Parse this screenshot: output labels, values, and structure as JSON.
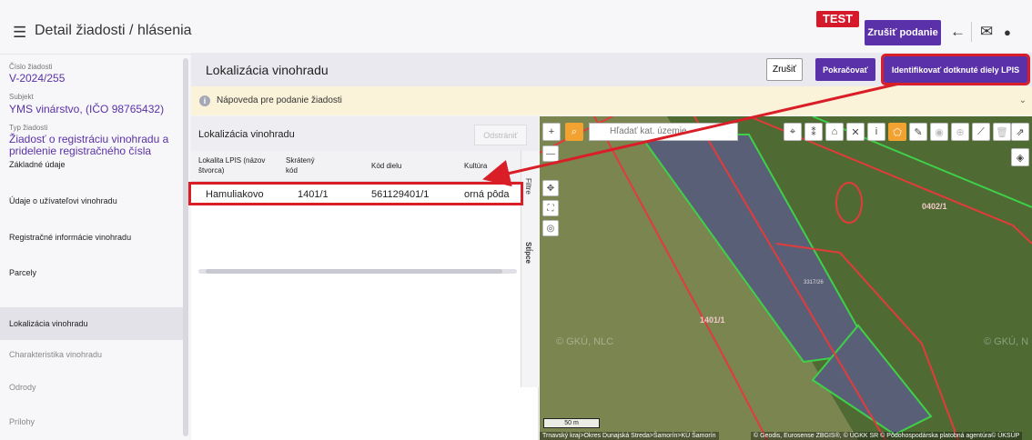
{
  "topbar": {
    "menu_icon": "☰",
    "title": "Detail žiadosti / hlásenia",
    "test_badge": "TEST",
    "cancel_label": "Zrušiť podanie",
    "back_icon": "←",
    "mail_icon": "✉",
    "user_icon": "●"
  },
  "sidebar": {
    "fields": [
      {
        "label": "Číslo žiadosti",
        "value": "V-2024/255"
      },
      {
        "label": "Subjekt",
        "value": "YMS vinárstvo, (IČO 98765432)"
      },
      {
        "label": "Typ žiadosti",
        "value": "Žiadosť o registráciu vinohradu a pridelenie registračného čísla"
      }
    ],
    "items": [
      {
        "label": "Základné údaje"
      },
      {
        "label": "Údaje o užívateľovi vinohradu"
      },
      {
        "label": "Registračné informácie vinohradu"
      },
      {
        "label": "Parcely"
      },
      {
        "label": "Lokalizácia vinohradu",
        "active": true
      },
      {
        "label": "Charakteristika vinohradu"
      },
      {
        "label": "Odrody"
      },
      {
        "label": "Prílohy"
      }
    ]
  },
  "section": {
    "title": "Lokalizácia vinohradu",
    "cancel": "Zrušiť",
    "continue": "Pokračovať",
    "identify": "Identifikovať dotknuté diely LPIS"
  },
  "help": {
    "icon": "i",
    "text": "Nápoveda pre podanie žiadosti",
    "chevron": "⌄"
  },
  "table": {
    "title": "Lokalizácia vinohradu",
    "remove": "Odstrániť",
    "columns": [
      "Lokalita LPIS (názov štvorca)",
      "Skrátený kód",
      "Kód dielu",
      "Kultúra"
    ],
    "rows": [
      {
        "lokalita": "Hamuliakovo",
        "kod": "1401/1",
        "diel": "561129401/1",
        "kultura": "orná pôda"
      }
    ],
    "side_filter": "Filtre",
    "side_columns": "Stĺpce"
  },
  "map": {
    "search_placeholder": "Hľadať kat. územie",
    "parcel_labels": [
      "1401/1",
      "0402/1",
      "3317/26"
    ],
    "watermarks": [
      "© GKÚ, NLC",
      "© GKÚ, N"
    ],
    "scale": "50 m",
    "footer_left": "Trnavský kraj>Okres Dunajská Streda>Šamorín>KÚ Šamorín",
    "footer_right": "© Geodis, Eurosense ZBGIS®, © ÚGKK SR © Pôdohospodárska platobná agentúra© ÚKSÚP"
  },
  "colors": {
    "accent": "#5a31a8",
    "test_badge": "#d6182b",
    "highlight": "#d91e27",
    "help_bg": "#fbf3d9",
    "map_orange": "#f2a230"
  }
}
